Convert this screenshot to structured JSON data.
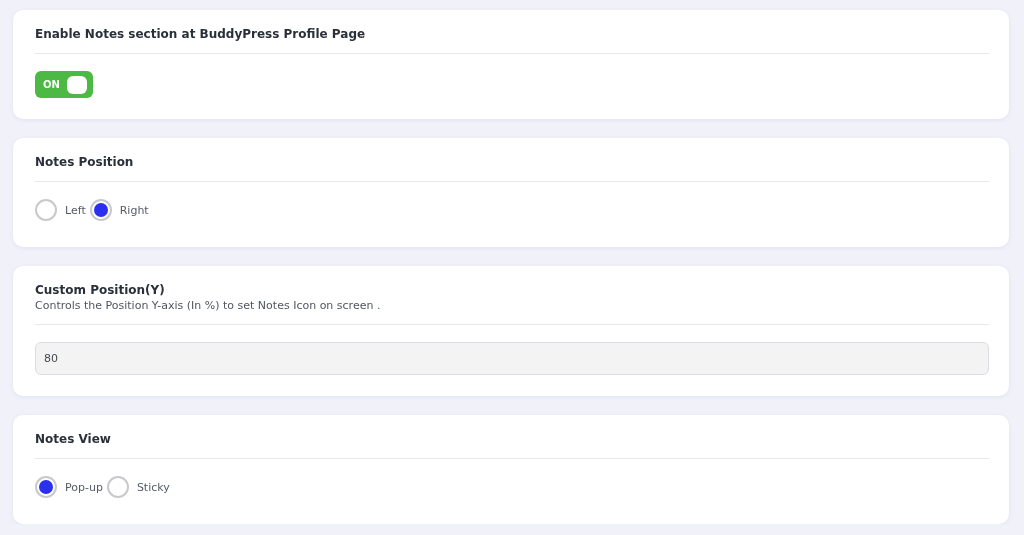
{
  "sections": [
    {
      "kind": "toggle",
      "title": "Enable Notes section at BuddyPress Profile Page",
      "toggle": {
        "label": "ON",
        "on": true
      }
    },
    {
      "kind": "radio",
      "title": "Notes Position",
      "options": [
        {
          "label": "Left",
          "selected": false
        },
        {
          "label": "Right",
          "selected": true
        }
      ]
    },
    {
      "kind": "input",
      "title": "Custom Position(Y)",
      "description": "Controls the Position Y-axis (In %) to set Notes Icon on screen .",
      "value": "80"
    },
    {
      "kind": "radio",
      "title": "Notes View",
      "options": [
        {
          "label": "Pop-up",
          "selected": true
        },
        {
          "label": "Sticky",
          "selected": false
        }
      ]
    }
  ]
}
